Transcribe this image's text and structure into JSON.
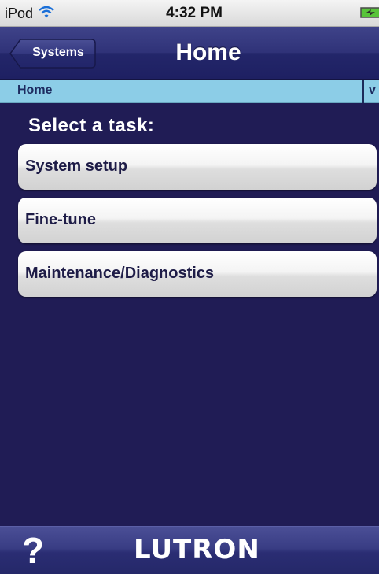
{
  "status_bar": {
    "device": "iPod",
    "time": "4:32 PM",
    "wifi_icon": "wifi-icon",
    "battery_icon": "battery-charging-icon"
  },
  "nav_bar": {
    "back_label": "Systems",
    "title": "Home"
  },
  "breadcrumb": {
    "current": "Home",
    "version": "v"
  },
  "main": {
    "prompt": "Select a task:",
    "tasks": [
      {
        "label": "System setup"
      },
      {
        "label": "Fine-tune"
      },
      {
        "label": "Maintenance/Diagnostics"
      }
    ]
  },
  "bottom_bar": {
    "help": "?",
    "brand": "LUTRON",
    "help_icon": "question-mark-icon"
  },
  "colors": {
    "background": "#201c55",
    "nav_bar": "#2f3278",
    "breadcrumb": "#8ccde7",
    "button_text": "#1e1c47"
  }
}
